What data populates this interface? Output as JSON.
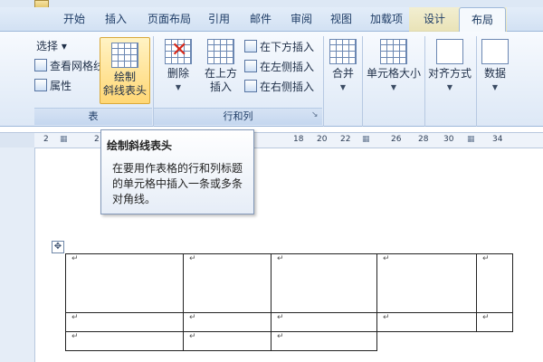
{
  "tabs": [
    "开始",
    "插入",
    "页面布局",
    "引用",
    "邮件",
    "审阅",
    "视图",
    "加载项",
    "设计",
    "布局"
  ],
  "active_tab": "布局",
  "ribbon": {
    "table_group": {
      "label": "表",
      "select": "选择 ▾",
      "gridlines": "查看网格线",
      "properties": "属性",
      "draw_diagonal_line1": "绘制",
      "draw_diagonal_line2": "斜线表头"
    },
    "rows_cols_group": {
      "label": "行和列",
      "delete": "删除",
      "insert_above_line1": "在上方",
      "insert_above_line2": "插入",
      "insert_below": "在下方插入",
      "insert_left": "在左侧插入",
      "insert_right": "在右侧插入"
    },
    "merge": "合并",
    "cell_size": "单元格大小",
    "alignment": "对齐方式",
    "data": "数据"
  },
  "ruler_ticks": [
    "2",
    "2",
    "18",
    "20",
    "22",
    "26",
    "28",
    "30",
    "34"
  ],
  "tooltip": {
    "title": "绘制斜线表头",
    "description": "在要用作表格的行和列标题的单元格中插入一条或多条对角线。"
  },
  "table": {
    "move_handle": "✥",
    "cell_mark": "↵",
    "rows": [
      [
        "↵",
        "↵",
        "↵",
        "↵",
        "↵"
      ],
      [
        "↵",
        "↵",
        "↵",
        "↵",
        "↵"
      ],
      [
        "↵",
        "↵",
        "↵",
        "",
        ""
      ]
    ]
  },
  "colors": {
    "ribbon_bg": "#dde8f6",
    "highlight": "#ffd775",
    "delete_red": "#d8291a"
  }
}
